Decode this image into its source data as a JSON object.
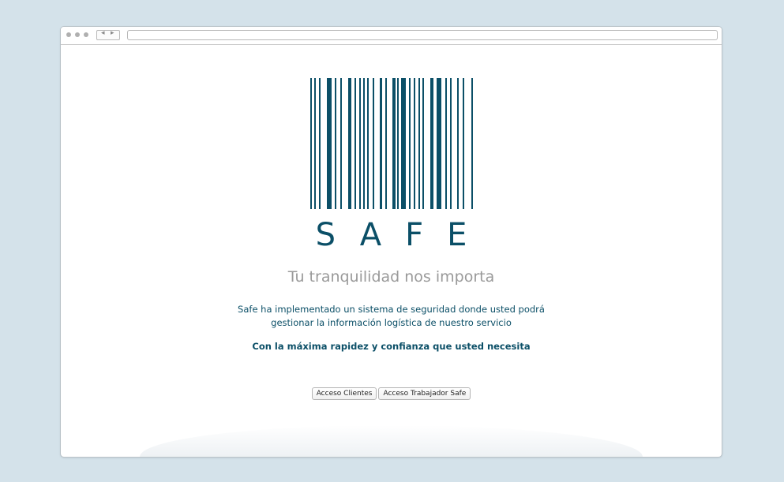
{
  "browser": {
    "nav_back_icon": "chevron-left-icon",
    "nav_forward_icon": "chevron-right-icon",
    "url": ""
  },
  "logo": {
    "brand": "SAFE",
    "color": "#0b4f67"
  },
  "hero": {
    "tagline": "Tu tranquilidad nos importa",
    "description_line1": "Safe ha implementado un sistema de seguridad donde usted podrá",
    "description_line2": "gestionar la información logística de nuestro servicio",
    "highlight": "Con la máxima rapidez y confianza que usted necesita"
  },
  "actions": {
    "clients_label": "Acceso Clientes",
    "workers_label": "Acceso Trabajador Safe"
  }
}
